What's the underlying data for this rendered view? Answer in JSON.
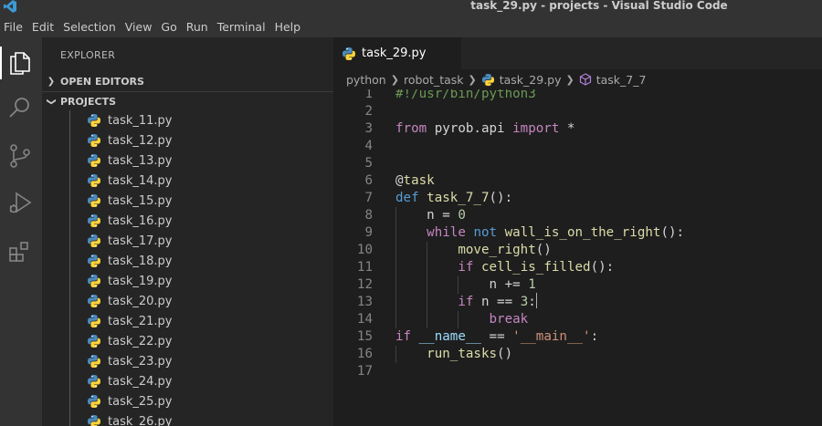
{
  "window": {
    "title": "task_29.py - projects - Visual Studio Code"
  },
  "menu": [
    "File",
    "Edit",
    "Selection",
    "View",
    "Go",
    "Run",
    "Terminal",
    "Help"
  ],
  "activity_bar": [
    "files-icon",
    "search-icon",
    "source-control-icon",
    "run-debug-icon",
    "extensions-icon"
  ],
  "sidebar": {
    "title": "EXPLORER",
    "open_editors": "OPEN EDITORS",
    "projects": "PROJECTS",
    "files": [
      "task_11.py",
      "task_12.py",
      "task_13.py",
      "task_14.py",
      "task_15.py",
      "task_16.py",
      "task_17.py",
      "task_18.py",
      "task_19.py",
      "task_20.py",
      "task_21.py",
      "task_22.py",
      "task_23.py",
      "task_24.py",
      "task_25.py",
      "task_26.py"
    ]
  },
  "tab": {
    "label": "task_29.py"
  },
  "breadcrumb": {
    "folder1": "python",
    "folder2": "robot_task",
    "file": "task_29.py",
    "symbol": "task_7_7"
  },
  "code_lines": [
    {
      "n": "1",
      "t": "#!/usr/bin/python3"
    },
    {
      "n": "2",
      "t": ""
    },
    {
      "n": "3",
      "t": "from pyrob.api import *"
    },
    {
      "n": "4",
      "t": ""
    },
    {
      "n": "5",
      "t": ""
    },
    {
      "n": "6",
      "t": "@task"
    },
    {
      "n": "7",
      "t": "def task_7_7():"
    },
    {
      "n": "8",
      "t": "    n = 0"
    },
    {
      "n": "9",
      "t": "    while not wall_is_on_the_right():"
    },
    {
      "n": "10",
      "t": "        move_right()"
    },
    {
      "n": "11",
      "t": "        if cell_is_filled():"
    },
    {
      "n": "12",
      "t": "            n += 1"
    },
    {
      "n": "13",
      "t": "        if n == 3:"
    },
    {
      "n": "14",
      "t": "            break"
    },
    {
      "n": "15",
      "t": "if __name__ == '__main__':"
    },
    {
      "n": "16",
      "t": "    run_tasks()"
    },
    {
      "n": "17",
      "t": ""
    }
  ],
  "colors": {
    "keyword": "#569cd6",
    "control": "#c586c0",
    "function": "#dcdcaa",
    "number": "#b5cea8",
    "string": "#ce9178",
    "comment": "#6a9955"
  }
}
